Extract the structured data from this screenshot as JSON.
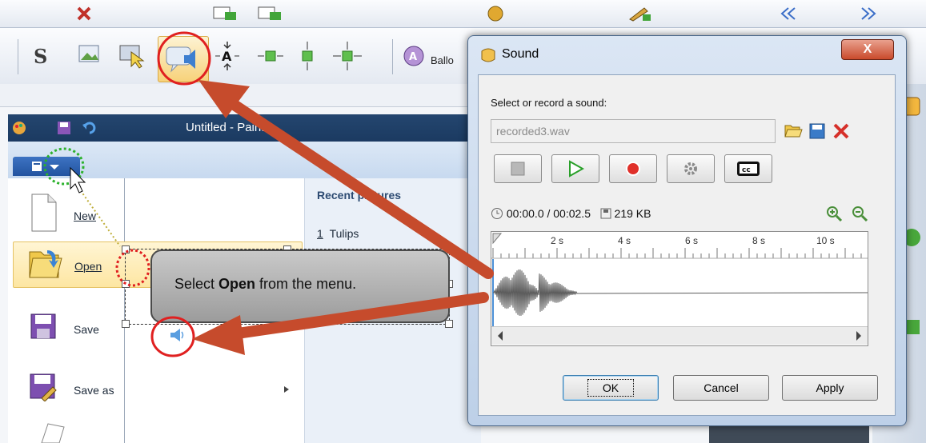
{
  "toolbar": {
    "balloon_label": "Ballo",
    "icons": [
      "close-icon",
      "undo-icon",
      "redo-icon",
      "add-slide-icon",
      "insert-icon",
      "color-icon",
      "highlight-icon",
      "fx-icon",
      "settings-icon",
      "pencil-icon",
      "zoom-icon",
      "nav-first-icon",
      "nav-prev-icon",
      "nav-next-icon"
    ]
  },
  "paint": {
    "title": "Untitled - Paint",
    "menu": {
      "new_label": "New",
      "open_label": "Open",
      "save_label": "Save",
      "save_as_label": "Save as"
    },
    "recent": {
      "heading": "Recent pictures",
      "item_number": "1",
      "item_name": "Tulips"
    }
  },
  "callout": {
    "text_before": "Select ",
    "text_bold": "Open",
    "text_after": " from the menu."
  },
  "dialog": {
    "title": "Sound",
    "close_label": "X",
    "prompt": "Select or record a sound:",
    "file_value": "recorded3.wav",
    "time_readout": "00:00.0 / 00:02.5",
    "size_readout": "219 KB",
    "ruler_ticks": [
      "2 s",
      "4 s",
      "6 s",
      "8 s",
      "10 s"
    ],
    "ok_label": "OK",
    "cancel_label": "Cancel",
    "apply_label": "Apply"
  },
  "colors": {
    "arrow": "#c64b2c",
    "highlight_ring": "#e02020",
    "green_ring": "#2db22d"
  }
}
